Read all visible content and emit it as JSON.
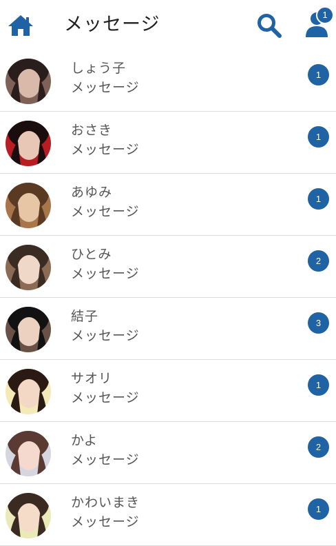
{
  "header": {
    "title": "メッセージ",
    "user_badge": "1",
    "icons": [
      "home-icon",
      "search-icon",
      "user-icon"
    ]
  },
  "accent_color": "#1f63a4",
  "messages": [
    {
      "name": "しょう子",
      "preview": "メッセージ",
      "unread": "1",
      "avatar_colors": [
        "#2a1e1c",
        "#d9b9a9",
        "#7e6258"
      ]
    },
    {
      "name": "おさき",
      "preview": "メッセージ",
      "unread": "1",
      "avatar_colors": [
        "#1a0d0d",
        "#e8c7b6",
        "#b81d24"
      ]
    },
    {
      "name": "あゆみ",
      "preview": "メッセージ",
      "unread": "1",
      "avatar_colors": [
        "#5b3a24",
        "#e7c6a6",
        "#a7764a"
      ]
    },
    {
      "name": "ひとみ",
      "preview": "メッセージ",
      "unread": "2",
      "avatar_colors": [
        "#3a2c22",
        "#f0d8c8",
        "#8c6b55"
      ]
    },
    {
      "name": "結子",
      "preview": "メッセージ",
      "unread": "3",
      "avatar_colors": [
        "#121212",
        "#ecd0c0",
        "#6a5146"
      ]
    },
    {
      "name": "サオリ",
      "preview": "メッセージ",
      "unread": "1",
      "avatar_colors": [
        "#2b1a14",
        "#f3d8c5",
        "#f5e9b8"
      ]
    },
    {
      "name": "かよ",
      "preview": "メッセージ",
      "unread": "2",
      "avatar_colors": [
        "#5a3a33",
        "#f5d9cf",
        "#d6d6e0"
      ]
    },
    {
      "name": "かわいまき",
      "preview": "メッセージ",
      "unread": "1",
      "avatar_colors": [
        "#3a2a22",
        "#f5dcc8",
        "#e9eab8"
      ]
    }
  ]
}
